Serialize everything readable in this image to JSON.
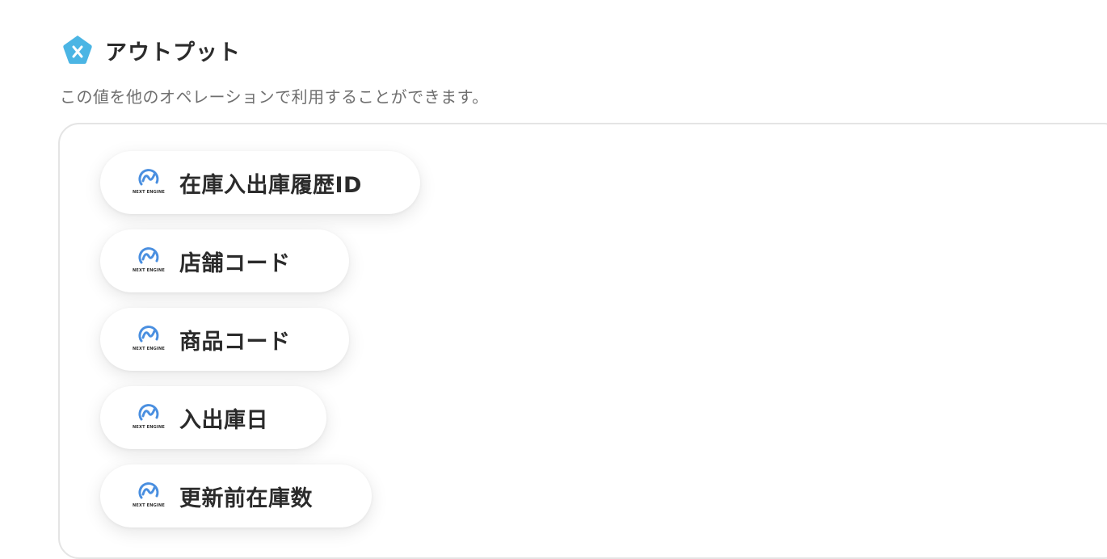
{
  "header": {
    "title": "アウトプット",
    "icon": "x-pentagon-icon",
    "icon_color": "#4bb5e4"
  },
  "description": "この値を他のオペレーションで利用することができます。",
  "outputs": {
    "logo_text": "NEXT ENGINE",
    "logo_color": "#4a8fe0",
    "items": [
      {
        "label": "在庫入出庫履歴ID"
      },
      {
        "label": "店舗コード"
      },
      {
        "label": "商品コード"
      },
      {
        "label": "入出庫日"
      },
      {
        "label": "更新前在庫数"
      }
    ]
  }
}
